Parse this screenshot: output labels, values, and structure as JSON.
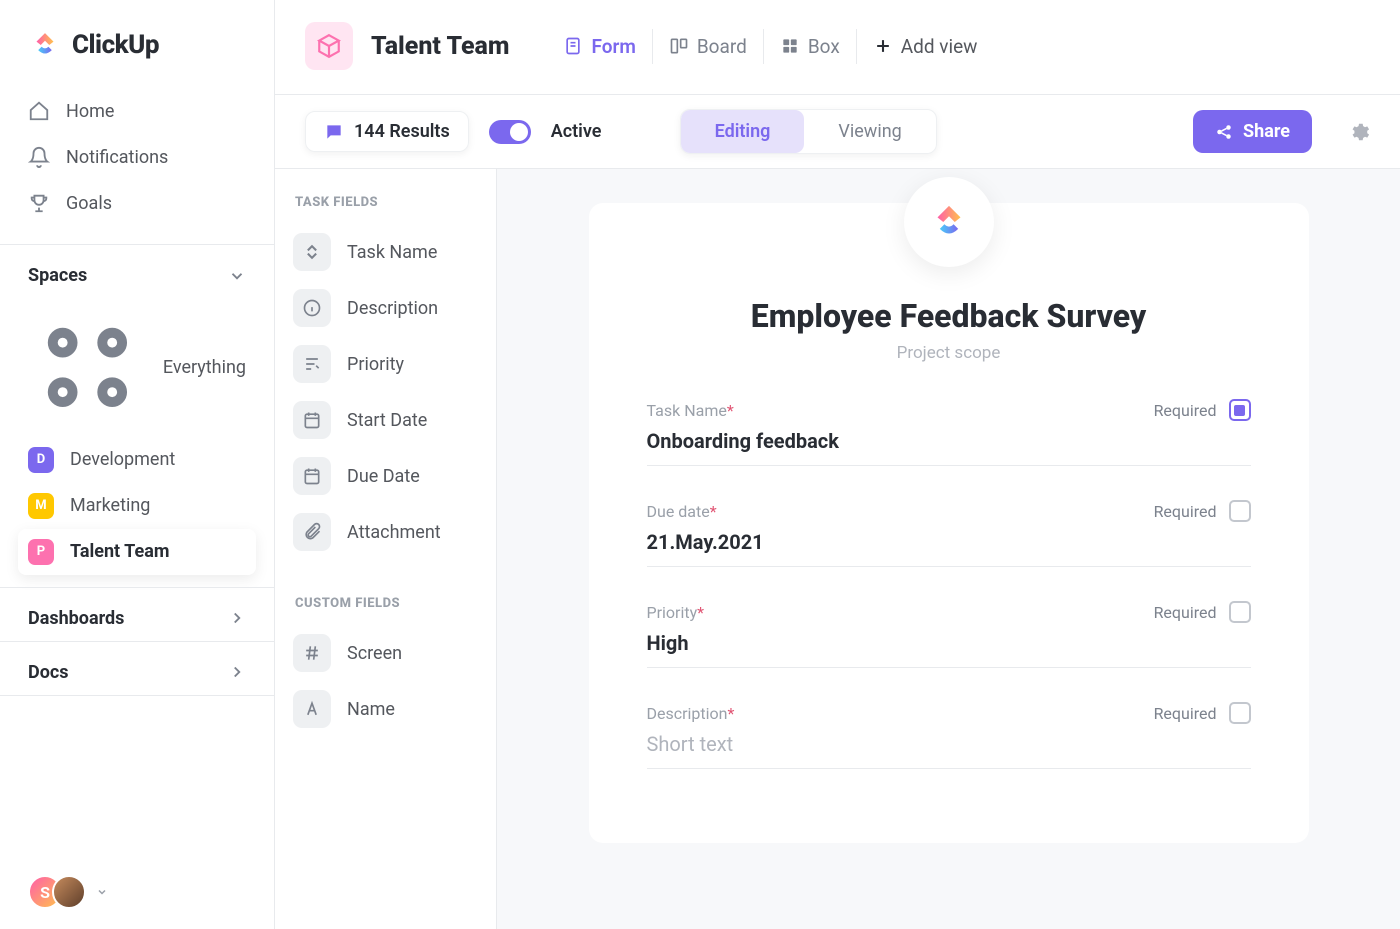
{
  "brand": "ClickUp",
  "nav": {
    "home": "Home",
    "notifications": "Notifications",
    "goals": "Goals"
  },
  "spaces": {
    "header": "Spaces",
    "everything": "Everything",
    "items": [
      {
        "badge": "D",
        "label": "Development"
      },
      {
        "badge": "M",
        "label": "Marketing"
      },
      {
        "badge": "P",
        "label": "Talent Team"
      }
    ]
  },
  "secondary_nav": {
    "dashboards": "Dashboards",
    "docs": "Docs"
  },
  "user_badge": "S",
  "header": {
    "title": "Talent Team",
    "views": [
      {
        "label": "Form",
        "active": true
      },
      {
        "label": "Board",
        "active": false
      },
      {
        "label": "Box",
        "active": false
      },
      {
        "label": "Add view",
        "active": false
      }
    ]
  },
  "subbar": {
    "results_label": "144 Results",
    "active_label": "Active",
    "mode_editing": "Editing",
    "mode_viewing": "Viewing",
    "share": "Share"
  },
  "fields_panel": {
    "task_fields_header": "TASK FIELDS",
    "task_fields": [
      "Task Name",
      "Description",
      "Priority",
      "Start Date",
      "Due Date",
      "Attachment"
    ],
    "custom_fields_header": "CUSTOM FIELDS",
    "custom_fields": [
      "Screen",
      "Name"
    ]
  },
  "form": {
    "title": "Employee Feedback Survey",
    "subtitle": "Project scope",
    "required_label": "Required",
    "fields": [
      {
        "label": "Task Name",
        "value": "Onboarding feedback",
        "required": true,
        "req_checked": true
      },
      {
        "label": "Due date",
        "value": "21.May.2021",
        "required": true,
        "req_checked": false
      },
      {
        "label": "Priority",
        "value": "High",
        "required": true,
        "req_checked": false
      },
      {
        "label": "Description",
        "value": "Short text",
        "placeholder": true,
        "required": true,
        "req_checked": false
      }
    ]
  }
}
